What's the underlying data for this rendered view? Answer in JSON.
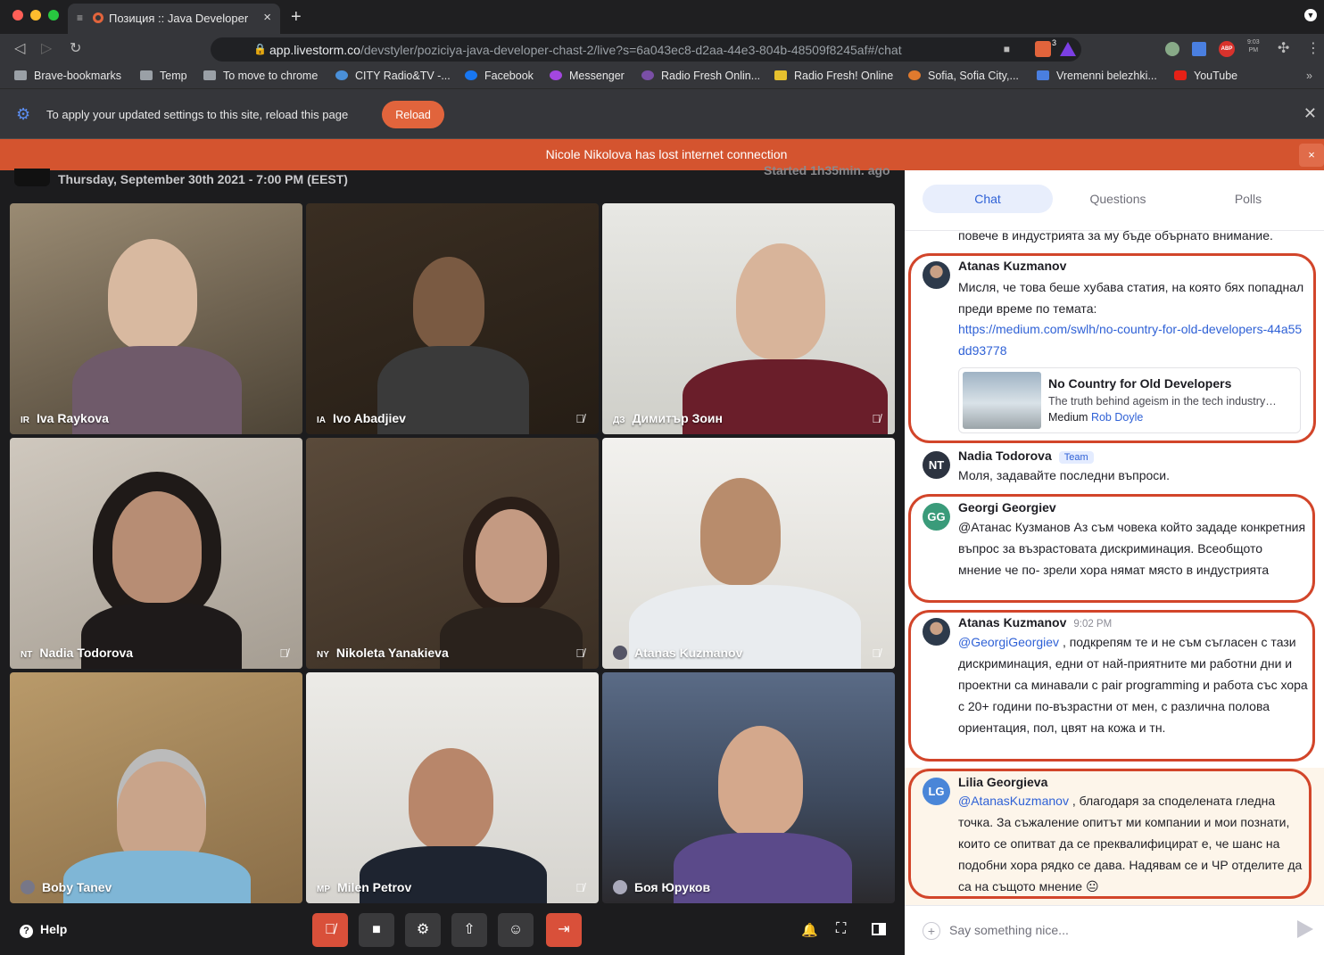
{
  "browser": {
    "tab_title": "Позиция :: Java Developer -",
    "url_host": "app.livestorm.co",
    "url_path": "/devstyler/poziciya-java-developer-chast-2/live?s=6a043ec8-d2aa-44e3-804b-48509f8245af#/chat",
    "brave_badge": "3",
    "clock_top": "9:03",
    "clock_bottom": "PM",
    "bookmarks": [
      "Brave-bookmarks",
      "Temp",
      "To move to chrome",
      "CITY Radio&TV -...",
      "Facebook",
      "Messenger",
      "Radio Fresh Onlin...",
      "Radio Fresh! Online",
      "Sofia, Sofia City,...",
      "Vremenni belezhki...",
      "YouTube"
    ]
  },
  "infobar": {
    "message": "To apply your updated settings to this site, reload this page",
    "reload_label": "Reload"
  },
  "alert": {
    "message": "Nicole Nikolova has lost internet connection",
    "close": "×"
  },
  "event": {
    "date": "Thursday, September 30th 2021 - 7:00 PM (EEST)",
    "started": "Started 1h35min. ago"
  },
  "participants": [
    {
      "initials": "IR",
      "name": "Iva Raykova",
      "muted": false
    },
    {
      "initials": "IA",
      "name": "Ivo Abadjiev",
      "muted": true
    },
    {
      "initials": "ДЗ",
      "name": "Димитър Зоин",
      "muted": true
    },
    {
      "initials": "NT",
      "name": "Nadia Todorova",
      "muted": true
    },
    {
      "initials": "NY",
      "name": "Nikoleta Yanakieva",
      "muted": true
    },
    {
      "initials": "",
      "name": "Atanas Kuzmanov",
      "muted": true
    },
    {
      "initials": "",
      "name": "Boby Tanev",
      "muted": false
    },
    {
      "initials": "MP",
      "name": "Milen Petrov",
      "muted": true
    },
    {
      "initials": "",
      "name": "Боя Юруков",
      "muted": false
    }
  ],
  "controls": {
    "help": "Help"
  },
  "chat": {
    "tabs": [
      "Chat",
      "Questions",
      "Polls"
    ],
    "cut_off_text": "повече в индустрията за му бъде обърнато внимание.",
    "messages": [
      {
        "author": "Atanas Kuzmanov",
        "text": "Мисля, че това беше хубава статия, на която бях попаднал преди време по темата:",
        "link": "https://medium.com/swlh/no-country-for-old-developers-44a55dd93778",
        "preview": {
          "title": "No Country for Old Developers",
          "desc": "The truth behind ageism in the tech industry…",
          "source": "Medium",
          "author": "Rob Doyle"
        }
      },
      {
        "author": "Nadia Todorova",
        "initials": "NT",
        "badge": "Team",
        "text": "Моля, задавайте последни въпроси."
      },
      {
        "author": "Georgi Georgiev",
        "initials": "GG",
        "text": "@Атанас Кузманов Аз съм човека който зададе конкретния въпрос за възрастовата дискриминация. Всеобщото мнение че по- зрели хора нямат място в индустрията"
      },
      {
        "author": "Atanas Kuzmanov",
        "time": "9:02 PM",
        "mention": "@GeorgiGeorgiev",
        "text": ", подкрепям те и не съм съгласен с тази дискриминация, едни от най-приятните ми работни дни и проектни са минавали с pair programming и работа със хора с 20+ години по-възрастни от мен, с различна полова ориентация, пол, цвят на кожа и тн."
      },
      {
        "author": "Lilia Georgieva",
        "initials": "LG",
        "mention": "@AtanasKuzmanov",
        "text": ", благодаря за споделената гледна точка. За съжаление опитът ми компании и мои познати, които се опитват да се преквалифицират е, че шанс на подобни хора рядко се дава. Надявам се и ЧР отделите да са на същото мнение 😐"
      }
    ],
    "composer_placeholder": "Say something nice..."
  },
  "colors": {
    "accent": "#2f61d6",
    "alert": "#d4542f",
    "highlight": "#d2452a"
  }
}
